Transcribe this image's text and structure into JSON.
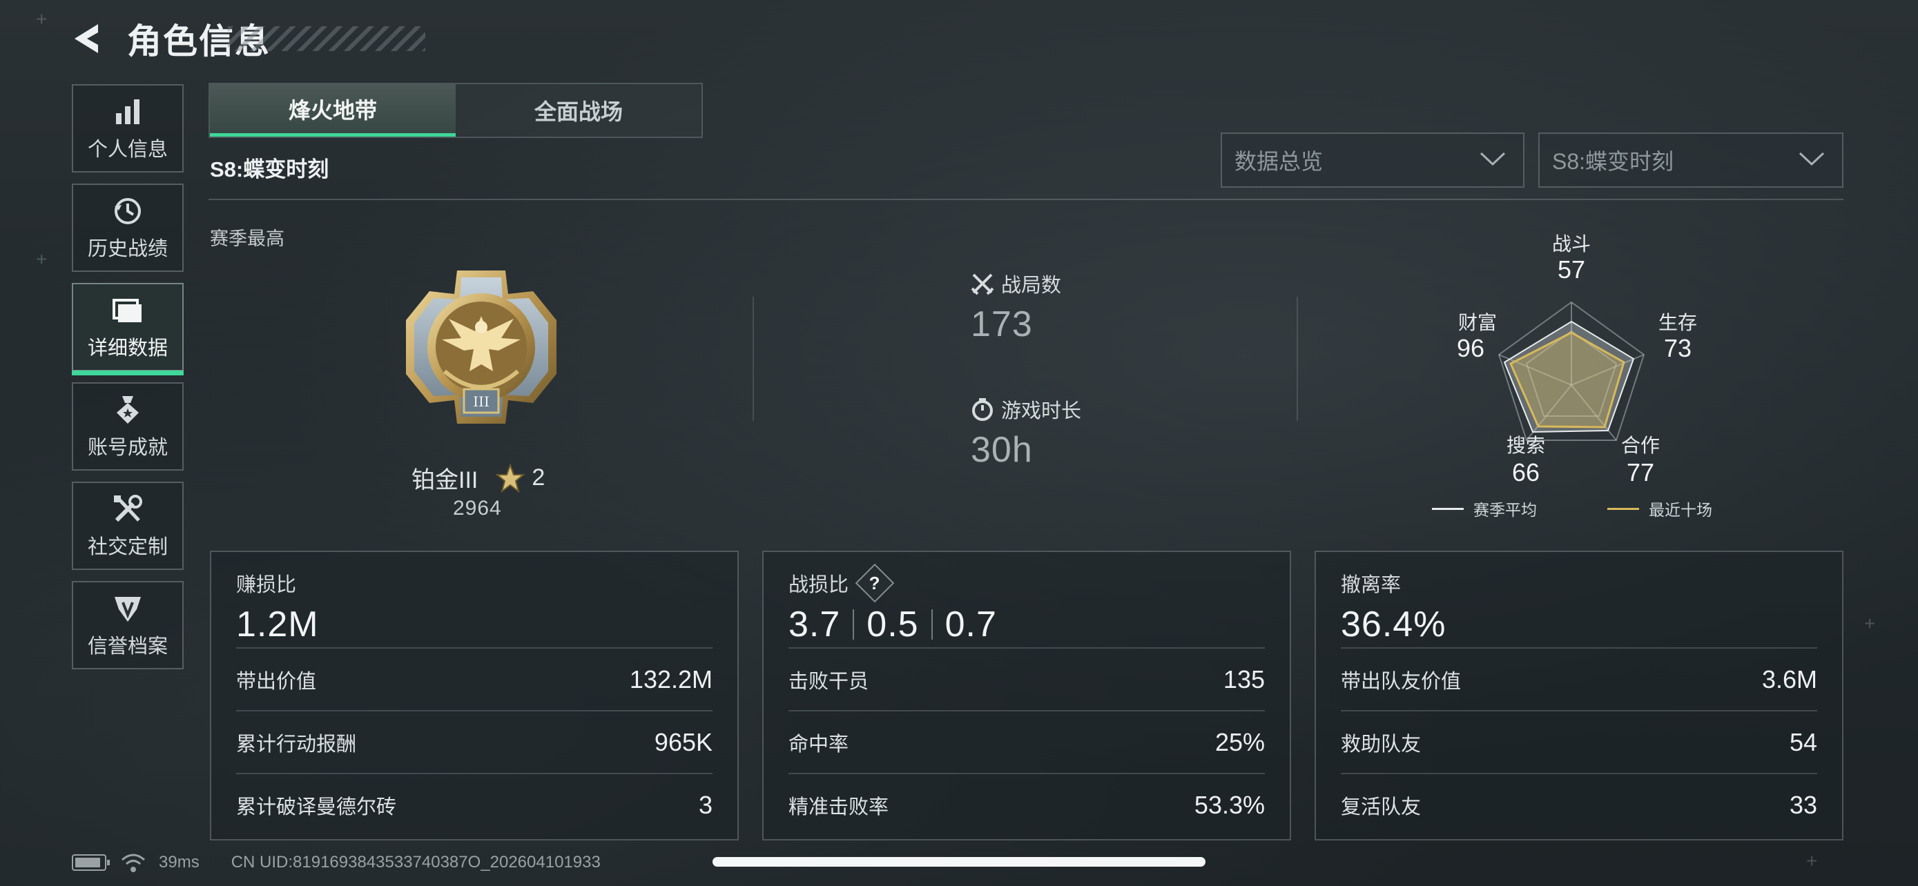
{
  "header": {
    "title": "角色信息",
    "back_icon": "back-arrow-icon"
  },
  "sidebar": {
    "items": [
      {
        "label": "个人信息",
        "icon": "bar-chart-icon",
        "active": false
      },
      {
        "label": "历史战绩",
        "icon": "history-clock-icon",
        "active": false
      },
      {
        "label": "详细数据",
        "icon": "folder-icon",
        "active": true
      },
      {
        "label": "账号成就",
        "icon": "achievement-medal-icon",
        "active": false
      },
      {
        "label": "社交定制",
        "icon": "tools-icon",
        "active": false
      },
      {
        "label": "信誉档案",
        "icon": "credit-shield-icon",
        "active": false
      }
    ]
  },
  "tabs": [
    {
      "label": "烽火地带",
      "active": true
    },
    {
      "label": "全面战场",
      "active": false
    }
  ],
  "season_label": "S8:蝶变时刻",
  "dropdowns": {
    "data_view": {
      "value": "数据总览"
    },
    "season": {
      "value": "S8:蝶变时刻"
    }
  },
  "rank": {
    "section_label": "赛季最高",
    "tier": "铂金III",
    "stars": "2",
    "score": "2964",
    "badge_numeral": "III"
  },
  "summary": {
    "matches_label": "战局数",
    "matches_value": "173",
    "playtime_label": "游戏时长",
    "playtime_value": "30h"
  },
  "radar": {
    "axes": [
      {
        "label": "战斗",
        "value": "57"
      },
      {
        "label": "生存",
        "value": "73"
      },
      {
        "label": "合作",
        "value": "77"
      },
      {
        "label": "搜索",
        "value": "66"
      },
      {
        "label": "财富",
        "value": "96"
      }
    ],
    "legend_season_avg": "赛季平均",
    "legend_recent": "最近十场",
    "colors": {
      "season_avg": "#e8ecee",
      "recent": "#d8b95a"
    }
  },
  "cards": {
    "profit": {
      "title": "赚损比",
      "main": "1.2M",
      "rows": [
        {
          "label": "带出价值",
          "value": "132.2M"
        },
        {
          "label": "累计行动报酬",
          "value": "965K"
        },
        {
          "label": "累计破译曼德尔砖",
          "value": "3"
        }
      ]
    },
    "kd": {
      "title": "战损比",
      "help": "?",
      "main_values": [
        "3.7",
        "0.5",
        "0.7"
      ],
      "rows": [
        {
          "label": "击败干员",
          "value": "135"
        },
        {
          "label": "命中率",
          "value": "25%"
        },
        {
          "label": "精准击败率",
          "value": "53.3%"
        }
      ]
    },
    "extract": {
      "title": "撤离率",
      "main": "36.4%",
      "rows": [
        {
          "label": "带出队友价值",
          "value": "3.6M"
        },
        {
          "label": "救助队友",
          "value": "54"
        },
        {
          "label": "复活队友",
          "value": "33"
        }
      ]
    }
  },
  "footer": {
    "ping": "39ms",
    "uid": "CN UID:8191693843533740387O_202604101933"
  },
  "accent_color": "#3ed89a"
}
